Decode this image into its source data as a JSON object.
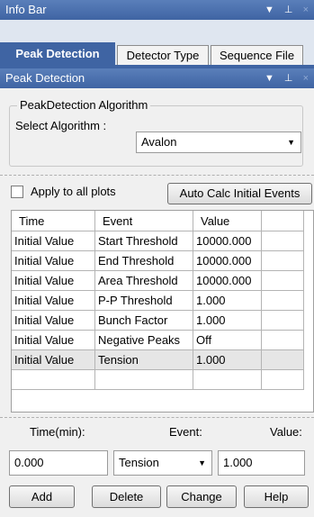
{
  "info_bar": {
    "title": "Info Bar"
  },
  "title_controls": {
    "dropdown": "▼",
    "pin": "⊥",
    "close": "×"
  },
  "tabs": [
    {
      "label": "Peak Detection",
      "active": true
    },
    {
      "label": "Detector Type",
      "active": false
    },
    {
      "label": "Sequence File",
      "active": false
    }
  ],
  "panel": {
    "title": "Peak Detection"
  },
  "algorithm_group": {
    "title": "PeakDetection Algorithm",
    "select_label": "Select Algorithm :",
    "select_value": "Avalon"
  },
  "apply_all": {
    "label": "Apply to all plots",
    "checked": false
  },
  "auto_calc_button": "Auto Calc Initial Events",
  "table": {
    "headers": [
      "Time",
      "Event",
      "Value"
    ],
    "rows": [
      [
        "Initial Value",
        "Start Threshold",
        "10000.000"
      ],
      [
        "Initial Value",
        "End Threshold",
        "10000.000"
      ],
      [
        "Initial Value",
        "Area Threshold",
        "10000.000"
      ],
      [
        "Initial Value",
        "P-P Threshold",
        "1.000"
      ],
      [
        "Initial Value",
        "Bunch Factor",
        "1.000"
      ],
      [
        "Initial Value",
        "Negative Peaks",
        "Off"
      ],
      [
        "Initial Value",
        "Tension",
        "1.000"
      ]
    ],
    "selected_row": 6
  },
  "edit": {
    "time_label": "Time(min):",
    "event_label": "Event:",
    "value_label": "Value:",
    "time_value": "0.000",
    "event_value": "Tension",
    "value_value": "1.000"
  },
  "buttons": {
    "add": "Add",
    "delete": "Delete",
    "change": "Change",
    "help": "Help"
  }
}
